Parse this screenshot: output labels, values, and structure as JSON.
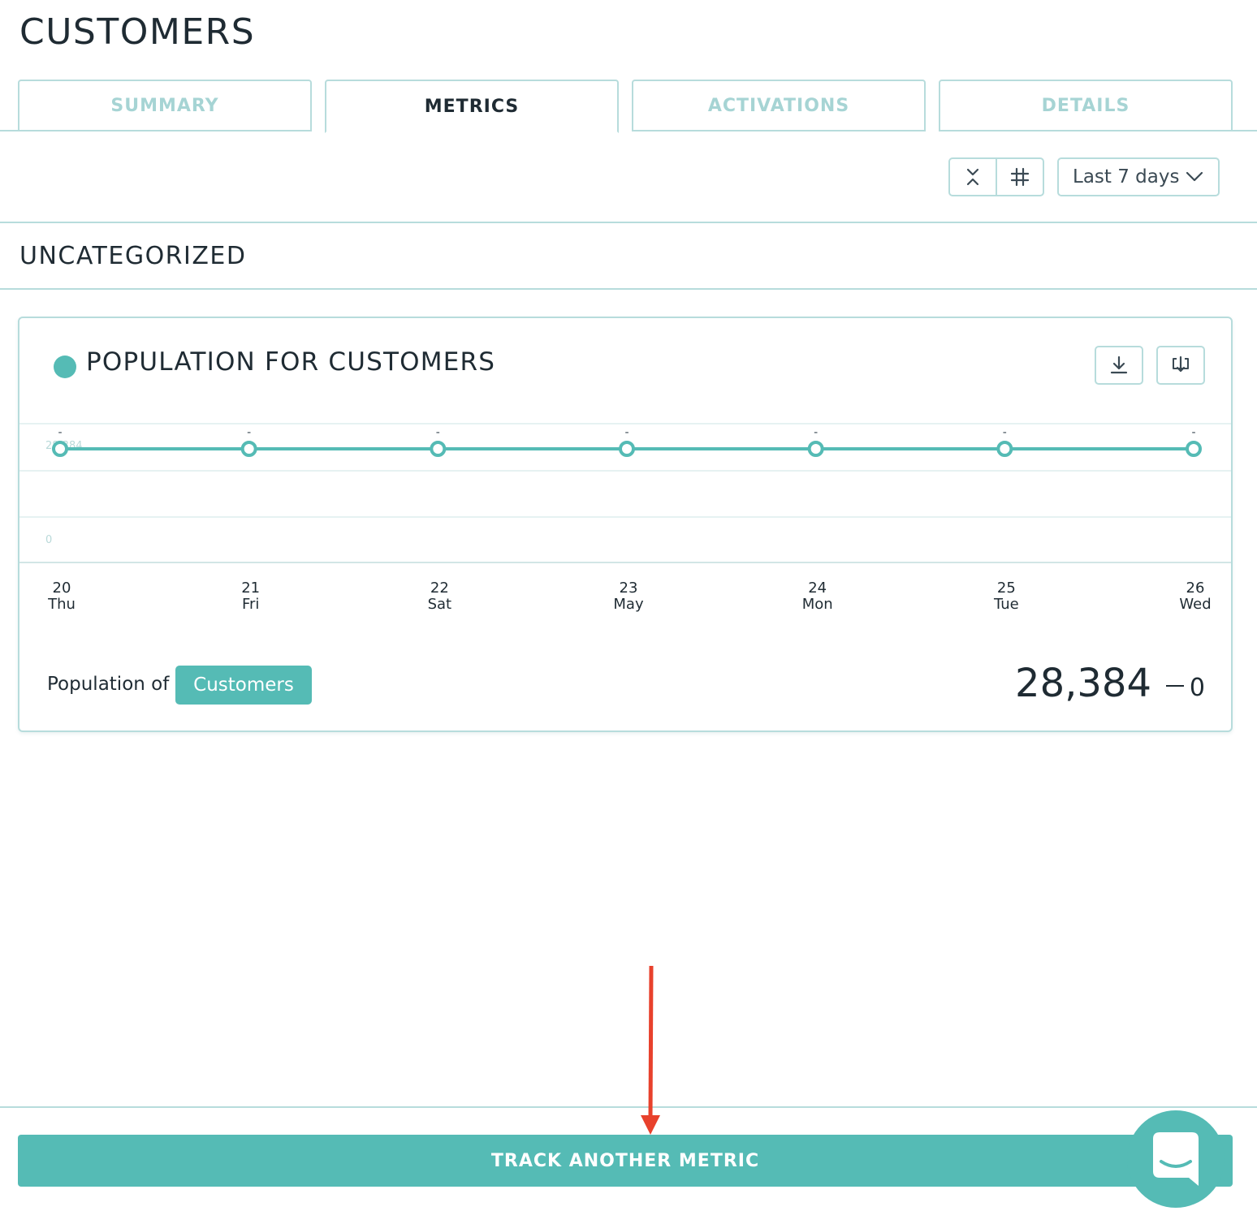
{
  "page": {
    "title": "CUSTOMERS"
  },
  "tabs": [
    {
      "label": "SUMMARY",
      "active": false
    },
    {
      "label": "METRICS",
      "active": true
    },
    {
      "label": "ACTIVATIONS",
      "active": false
    },
    {
      "label": "DETAILS",
      "active": false
    }
  ],
  "toolbar": {
    "icons": [
      "collapse-icon",
      "hash-icon"
    ],
    "date_range": "Last 7 days"
  },
  "section": {
    "title": "UNCATEGORIZED"
  },
  "card": {
    "title": "POPULATION FOR CUSTOMERS",
    "icons": [
      "download-icon",
      "export-icon"
    ],
    "population_label": "Population of",
    "population_chip": "Customers",
    "value": "28,384",
    "delta": "0"
  },
  "chart_data": {
    "type": "line",
    "x": [
      {
        "day": "20",
        "weekday": "Thu"
      },
      {
        "day": "21",
        "weekday": "Fri"
      },
      {
        "day": "22",
        "weekday": "Sat"
      },
      {
        "day": "23",
        "weekday": "May"
      },
      {
        "day": "24",
        "weekday": "Mon"
      },
      {
        "day": "25",
        "weekday": "Tue"
      },
      {
        "day": "26",
        "weekday": "Wed"
      }
    ],
    "series": [
      {
        "values": [
          28384,
          28384,
          28384,
          28384,
          28384,
          28384,
          28384
        ]
      }
    ],
    "point_labels": [
      "-",
      "-",
      "-",
      "-",
      "-",
      "-",
      "-"
    ],
    "y_ticks": [
      "28,384",
      "0"
    ],
    "ylim": [
      0,
      28384
    ],
    "grid": true,
    "color": "#55bbb5"
  },
  "footer": {
    "track_button": "TRACK ANOTHER METRIC"
  },
  "colors": {
    "accent": "#55bbb5",
    "border": "#b7dcdc",
    "text": "#1f2b33",
    "annotation": "#e8412c"
  }
}
